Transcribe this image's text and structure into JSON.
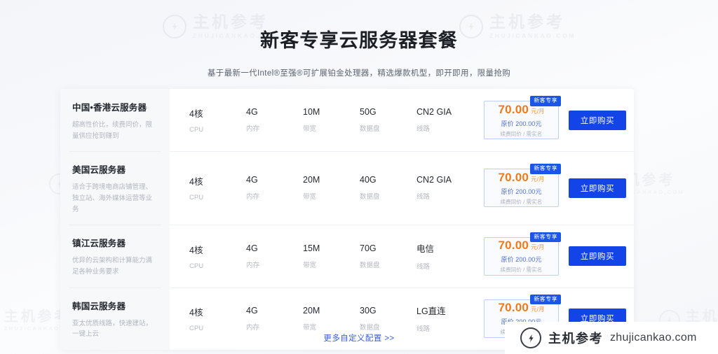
{
  "header": {
    "title": "新客专享云服务器套餐",
    "subtitle": "基于最新一代Intel®至强®可扩展铂金处理器，精选爆款机型，即开即用，限量抢购"
  },
  "spec_labels": {
    "cpu": "CPU",
    "memory": "内存",
    "bandwidth": "带宽",
    "disk": "数据盘",
    "line": "线路"
  },
  "common": {
    "badge": "新客专享",
    "price_unit": "元/月",
    "price_note": "续费同价 / 需实名",
    "buy_label": "立即购买",
    "orig_prefix": "原价 "
  },
  "plans": [
    {
      "title": "中国•香港云服务器",
      "desc": "超高性价比，续费同价，限量供应抢到赚到",
      "cpu": "4核",
      "memory": "4G",
      "bandwidth": "10M",
      "disk": "50G",
      "line": "CN2 GIA",
      "badge": "新客专享",
      "price": "70.00",
      "price_unit": "元/月",
      "orig_price": "原价 200.00元",
      "note": "续费同价 / 需实名",
      "buy_label": "立即购买"
    },
    {
      "title": "美国云服务器",
      "desc": "适合于跨境电商店铺管理、独立站、海外媒体运营等业务",
      "cpu": "4核",
      "memory": "4G",
      "bandwidth": "20M",
      "disk": "40G",
      "line": "CN2 GIA",
      "badge": "新客专享",
      "price": "70.00",
      "price_unit": "元/月",
      "orig_price": "原价 200.00元",
      "note": "续费同价 / 需实名",
      "buy_label": "立即购买"
    },
    {
      "title": "镇江云服务器",
      "desc": "优异的云架构和计算能力满足各种业务要求",
      "cpu": "4核",
      "memory": "4G",
      "bandwidth": "15M",
      "disk": "70G",
      "line": "电信",
      "badge": "新客专享",
      "price": "70.00",
      "price_unit": "元/月",
      "orig_price": "原价 200.00元",
      "note": "续费同价 / 需实名",
      "buy_label": "立即购买"
    },
    {
      "title": "韩国云服务器",
      "desc": "亚太优质线路，快速建站，一键上云",
      "cpu": "4核",
      "memory": "4G",
      "bandwidth": "20M",
      "disk": "30G",
      "line": "LG直连",
      "badge": "新客专享",
      "price": "70.00",
      "price_unit": "元/月",
      "orig_price": "原价 200.00元",
      "note": "续费同价 / 需实名",
      "buy_label": "立即购买"
    }
  ],
  "footer": {
    "more_link": "更多自定义配置 >>"
  },
  "watermark": {
    "cn": "主机参考",
    "en": "ZHUJICANKAO.COM",
    "domain": "zhujicankao.com"
  },
  "colors": {
    "accent_blue": "#1344e8",
    "price_orange": "#f07a1a",
    "orig_blue": "#4d6fd4",
    "panel_gray": "#f7f8fa"
  }
}
